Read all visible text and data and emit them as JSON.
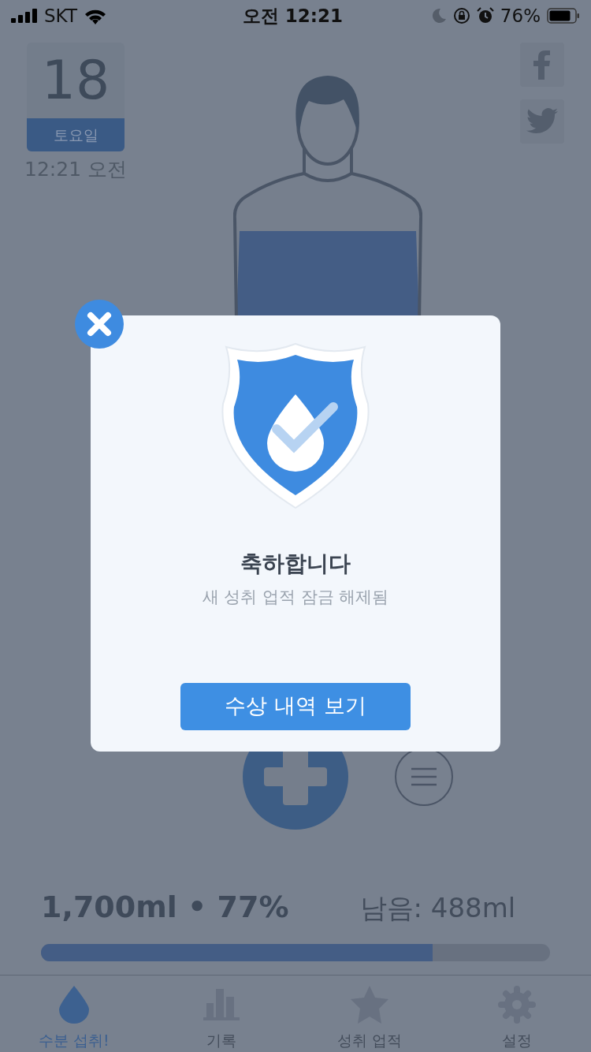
{
  "status_bar": {
    "carrier": "SKT",
    "time": "오전 12:21",
    "battery": "76%"
  },
  "date": {
    "day": "18",
    "weekday": "토요일",
    "time": "12:21 오전"
  },
  "dialog": {
    "title": "축하합니다",
    "subtitle": "새 성취 업적 잠금 해제됨",
    "button": "수상 내역 보기"
  },
  "stats": {
    "intake": "1,700ml • 77%",
    "remaining": "남음: 488ml",
    "level": 0.77
  },
  "tabs": [
    {
      "label": "수분 섭취!",
      "selected": true
    },
    {
      "label": "기록",
      "selected": false
    },
    {
      "label": "성취 업적",
      "selected": false
    },
    {
      "label": "설정",
      "selected": false
    }
  ]
}
